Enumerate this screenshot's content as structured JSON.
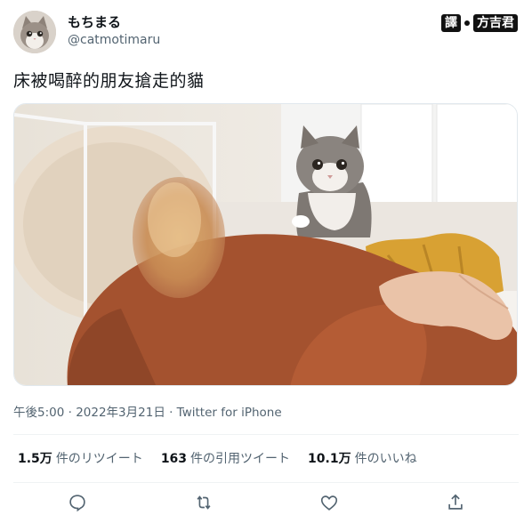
{
  "user": {
    "display_name": "もちまる",
    "handle": "@catmotimaru"
  },
  "watermark": {
    "left": "譯",
    "right": "方吉君"
  },
  "tweet": {
    "text": "床被喝醉的朋友搶走的貓",
    "meta": "午後5:00 · 2022年3月21日 · Twitter for iPhone"
  },
  "stats": [
    {
      "num": "1.5万",
      "label": "件のリツイート"
    },
    {
      "num": "163",
      "label": "件の引用ツイート"
    },
    {
      "num": "10.1万",
      "label": "件のいいね"
    }
  ],
  "actions": [
    {
      "icon": "reply-icon"
    },
    {
      "icon": "retweet-icon"
    },
    {
      "icon": "like-icon"
    },
    {
      "icon": "share-icon"
    }
  ],
  "colors": {
    "text": "#0f1419",
    "secondary": "#536471",
    "divider": "#eff3f4"
  }
}
